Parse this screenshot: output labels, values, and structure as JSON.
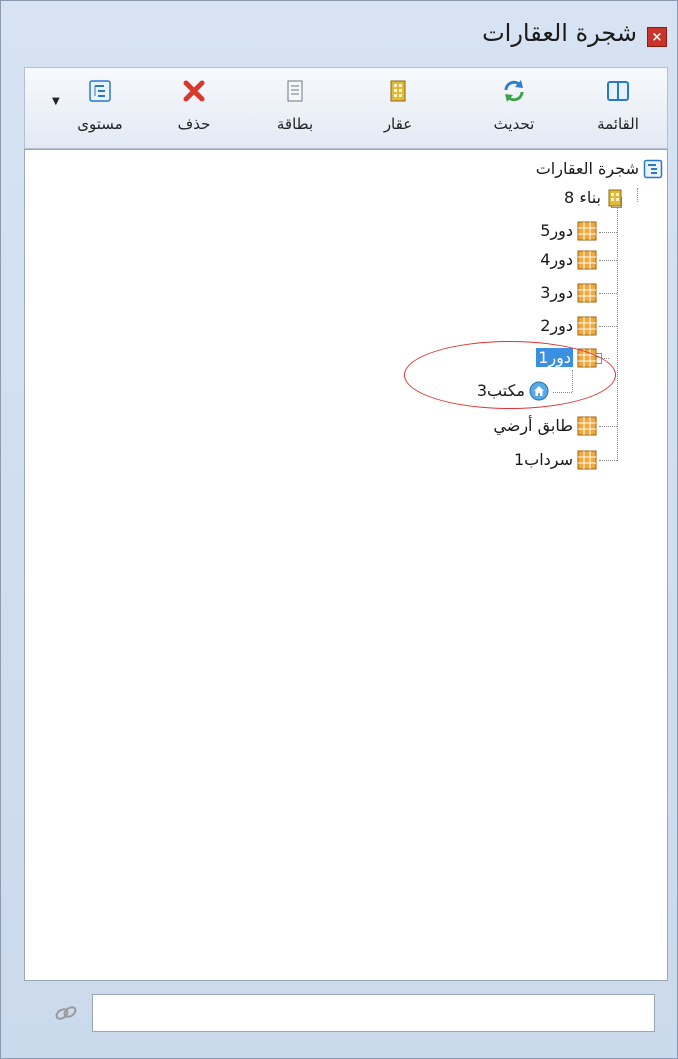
{
  "window": {
    "title": "شجرة العقارات",
    "close_label": "×"
  },
  "toolbar": {
    "list_label": "القائمة",
    "refresh_label": "تحديث",
    "property_label": "عقار",
    "card_label": "بطاقة",
    "delete_label": "حذف",
    "level_label": "مستوى",
    "level_arrow": "▼"
  },
  "tree": {
    "root_label": "شجرة العقارات",
    "building_label": "بناء 8",
    "floor5": "دور5",
    "floor4": "دور4",
    "floor3": "دور3",
    "floor2": "دور2",
    "floor1": "دور1",
    "office3": "مكتب3",
    "ground_floor": "طابق أرضي",
    "basement1": "سرداب1",
    "collapse_symbol": "−"
  },
  "search": {
    "value": ""
  },
  "colors": {
    "selection": "#3b8fe0",
    "highlight_ellipse": "#e03131",
    "close_button": "#c9342a"
  }
}
